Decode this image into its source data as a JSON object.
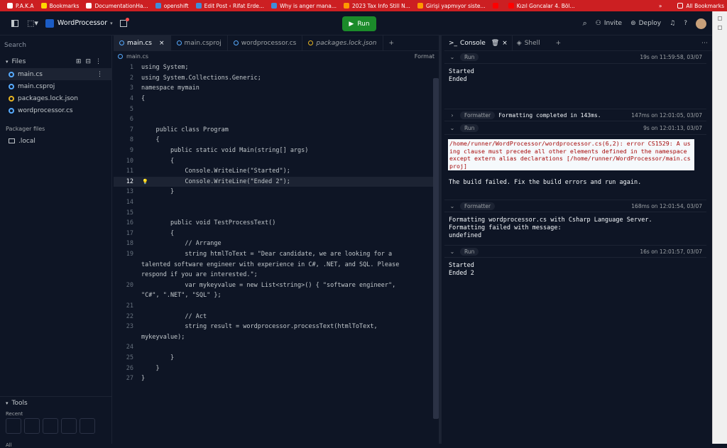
{
  "bookmarks": [
    {
      "label": "P.A.K.A",
      "color": "#ffffff"
    },
    {
      "label": "Bookmarks",
      "color": "#ffd700"
    },
    {
      "label": "DocumentationHa...",
      "color": "#ffffff"
    },
    {
      "label": "openshift",
      "color": "#3f8ed9"
    },
    {
      "label": "Edit Post ‹ Rifat Erde...",
      "color": "#3f8ed9"
    },
    {
      "label": "Why is anger mana...",
      "color": "#3f8ed9"
    },
    {
      "label": "2023 Tax Info Still N...",
      "color": "#ff9900"
    },
    {
      "label": "Girişi yapmıyor siste...",
      "color": "#ff9900"
    },
    {
      "label": "",
      "color": "#ff0000"
    },
    {
      "label": "Kızıl Goncalar 4. Böl...",
      "color": "#ff0000"
    }
  ],
  "bookmarks_more": "»",
  "all_bookmarks": "All Bookmarks",
  "top": {
    "app_name": "WordProcessor",
    "run": "Run",
    "invite": "Invite",
    "deploy": "Deploy",
    "help": "?"
  },
  "sidebar": {
    "search": "Search",
    "files_label": "Files",
    "files": [
      "main.cs",
      "main.csproj",
      "packages.lock.json",
      "wordprocessor.cs"
    ],
    "packager": "Packager files",
    "local": ".local",
    "tools": "Tools",
    "recent": "Recent",
    "all": "All"
  },
  "editor": {
    "tabs": [
      "main.cs",
      "main.csproj",
      "wordprocessor.cs",
      "packages.lock.json"
    ],
    "crumb": "main.cs",
    "format": "Format",
    "lines": [
      {
        "n": "1",
        "t": "using System;"
      },
      {
        "n": "2",
        "t": "using System.Collections.Generic;"
      },
      {
        "n": "3",
        "t": "namespace mymain"
      },
      {
        "n": "4",
        "t": "{"
      },
      {
        "n": "5",
        "t": ""
      },
      {
        "n": "6",
        "t": ""
      },
      {
        "n": "7",
        "t": "    public class Program"
      },
      {
        "n": "8",
        "t": "    {"
      },
      {
        "n": "9",
        "t": "        public static void Main(string[] args)"
      },
      {
        "n": "10",
        "t": "        {"
      },
      {
        "n": "11",
        "t": "            Console.WriteLine(\"Started\");"
      },
      {
        "n": "12",
        "t": "            Console.WriteLine(\"Ended 2\");"
      },
      {
        "n": "13",
        "t": "        }"
      },
      {
        "n": "14",
        "t": ""
      },
      {
        "n": "15",
        "t": ""
      },
      {
        "n": "16",
        "t": "        public void TestProcessText()"
      },
      {
        "n": "17",
        "t": "        {"
      },
      {
        "n": "18",
        "t": "            // Arrange"
      },
      {
        "n": "19",
        "t": "            string htmlToText = \"Dear candidate, we are looking for a"
      },
      {
        "n": "",
        "t": "talented software engineer with experience in C#, .NET, and SQL. Please"
      },
      {
        "n": "",
        "t": "respond if you are interested.\";"
      },
      {
        "n": "20",
        "t": "            var mykeyvalue = new List<string>() { \"software engineer\","
      },
      {
        "n": "",
        "t": "\"C#\", \".NET\", \"SQL\" };"
      },
      {
        "n": "21",
        "t": ""
      },
      {
        "n": "22",
        "t": "            // Act"
      },
      {
        "n": "23",
        "t": "            string result = wordprocessor.processText(htmlToText,"
      },
      {
        "n": "",
        "t": "mykeyvalue);"
      },
      {
        "n": "24",
        "t": ""
      },
      {
        "n": "25",
        "t": "        }"
      },
      {
        "n": "26",
        "t": "    }"
      },
      {
        "n": "27",
        "t": "}"
      }
    ]
  },
  "console": {
    "tab_console": "Console",
    "tab_shell": "Shell",
    "run1": {
      "pill": "Run",
      "meta": "19s on 11:59:58, 03/07",
      "out": "Started\nEnded"
    },
    "fmt1": {
      "pill": "Formatter",
      "msg": "Formatting completed in 143ms.",
      "meta": "147ms on 12:01:05, 03/07"
    },
    "run2": {
      "pill": "Run",
      "meta": "9s on 12:01:13, 03/07",
      "err": "/home/runner/WordProcessor/wordprocessor.cs(6,2): error CS1529: A using clause must precede all other elements defined in the namespace except extern alias declarations [/home/runner/WordProcessor/main.csproj]",
      "out": "The build failed. Fix the build errors and run again."
    },
    "fmt2": {
      "pill": "Formatter",
      "meta": "168ms on 12:01:54, 03/07",
      "out": "Formatting wordprocessor.cs with Csharp Language Server.\nFormatting failed with message:\nundefined"
    },
    "run3": {
      "pill": "Run",
      "meta": "16s on 12:01:57, 03/07",
      "out": "Started\nEnded 2"
    }
  }
}
